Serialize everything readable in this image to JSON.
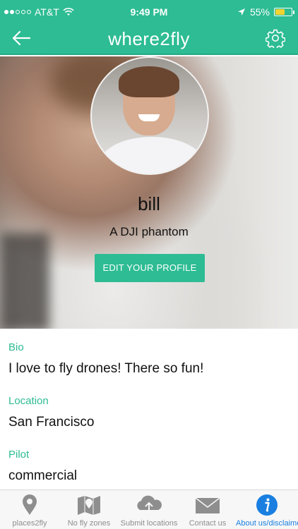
{
  "status_bar": {
    "carrier": "AT&T",
    "time": "9:49 PM",
    "battery": "55%"
  },
  "header": {
    "title": "where2fly"
  },
  "profile": {
    "name": "bill",
    "drone": "A DJI phantom",
    "edit_button_label": "EDIT YOUR PROFILE"
  },
  "details": [
    {
      "label": "Bio",
      "value": "I love to fly drones! There so fun!"
    },
    {
      "label": "Location",
      "value": "San Francisco"
    },
    {
      "label": "Pilot",
      "value": "commercial"
    }
  ],
  "tabs": [
    {
      "label": "places2fly",
      "icon": "map-pin-icon",
      "active": false
    },
    {
      "label": "No fly zones",
      "icon": "map-icon",
      "active": false
    },
    {
      "label": "Submit locations",
      "icon": "cloud-upload-icon",
      "active": false
    },
    {
      "label": "Contact us",
      "icon": "envelope-icon",
      "active": false
    },
    {
      "label": "About us/disclaimer",
      "icon": "info-icon",
      "active": true
    }
  ],
  "colors": {
    "brand": "#2dbc93",
    "tab_active": "#1a7fe0",
    "tab_inactive": "#8e8e8e"
  }
}
